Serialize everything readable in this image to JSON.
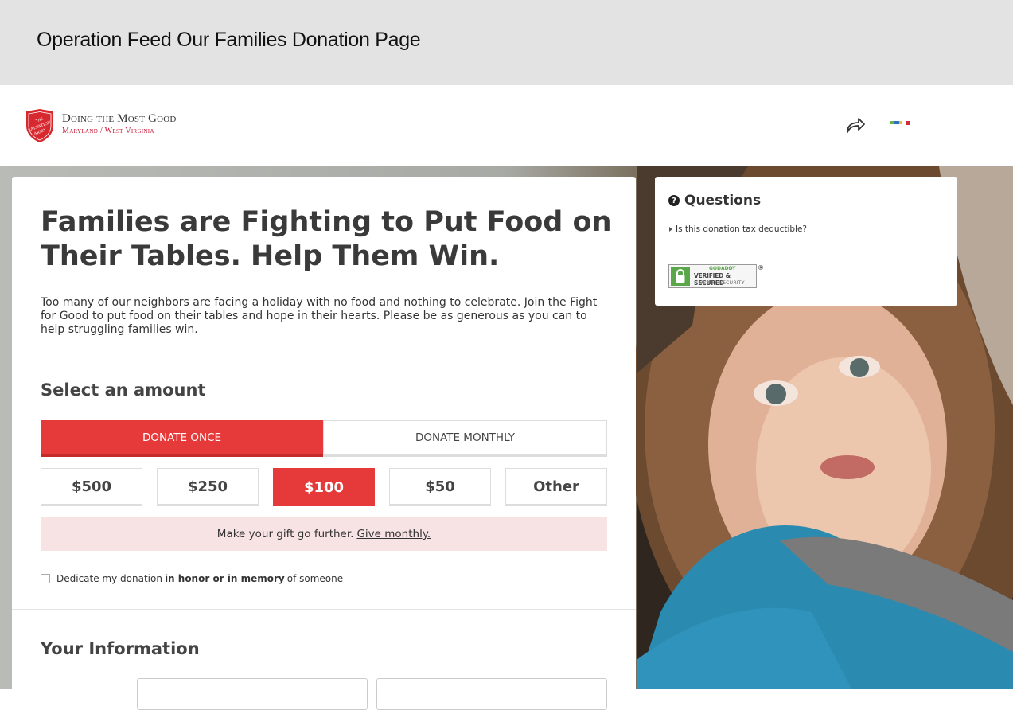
{
  "window": {
    "title": "Operation Feed Our Families Donation Page"
  },
  "brand": {
    "tagline": "Doing the Most Good",
    "region": "Maryland / West Virginia",
    "logo_text": "THE SALVATION ARMY"
  },
  "header": {
    "share_icon": "share-arrow-icon",
    "language_icon": "language-flags-icon"
  },
  "main": {
    "headline": "Families are Fighting to Put Food on Their Tables. Help Them Win.",
    "intro": "Too many of our neighbors are facing a holiday with no food and nothing to celebrate. Join the Fight for Good to put food on their tables and hope in their hearts. Please be as generous as you can to help struggling families win.",
    "select_title": "Select an amount",
    "frequency": [
      "DONATE ONCE",
      "DONATE MONTHLY"
    ],
    "frequency_selected": "DONATE ONCE",
    "amounts": [
      "$500",
      "$250",
      "$100",
      "$50",
      "Other"
    ],
    "amount_selected": "$100",
    "promo": {
      "text": "Make your gift go further.",
      "link": "Give monthly."
    },
    "dedicate": {
      "prefix": "Dedicate my donation",
      "bold": "in honor or in memory",
      "suffix": "of someone",
      "checked": false
    },
    "info_title": "Your Information"
  },
  "questions": {
    "title": "Questions",
    "items": [
      "Is this donation tax deductible?"
    ],
    "seal": {
      "brand": "GODADDY",
      "line1": "VERIFIED & SECURED",
      "line2": "VERIFY SECURITY",
      "mark": "®"
    }
  },
  "colors": {
    "accent": "#e63a3a",
    "promo_bg": "#f8e3e4",
    "brand_red": "#c8102e",
    "seal_green": "#5aa74a"
  }
}
